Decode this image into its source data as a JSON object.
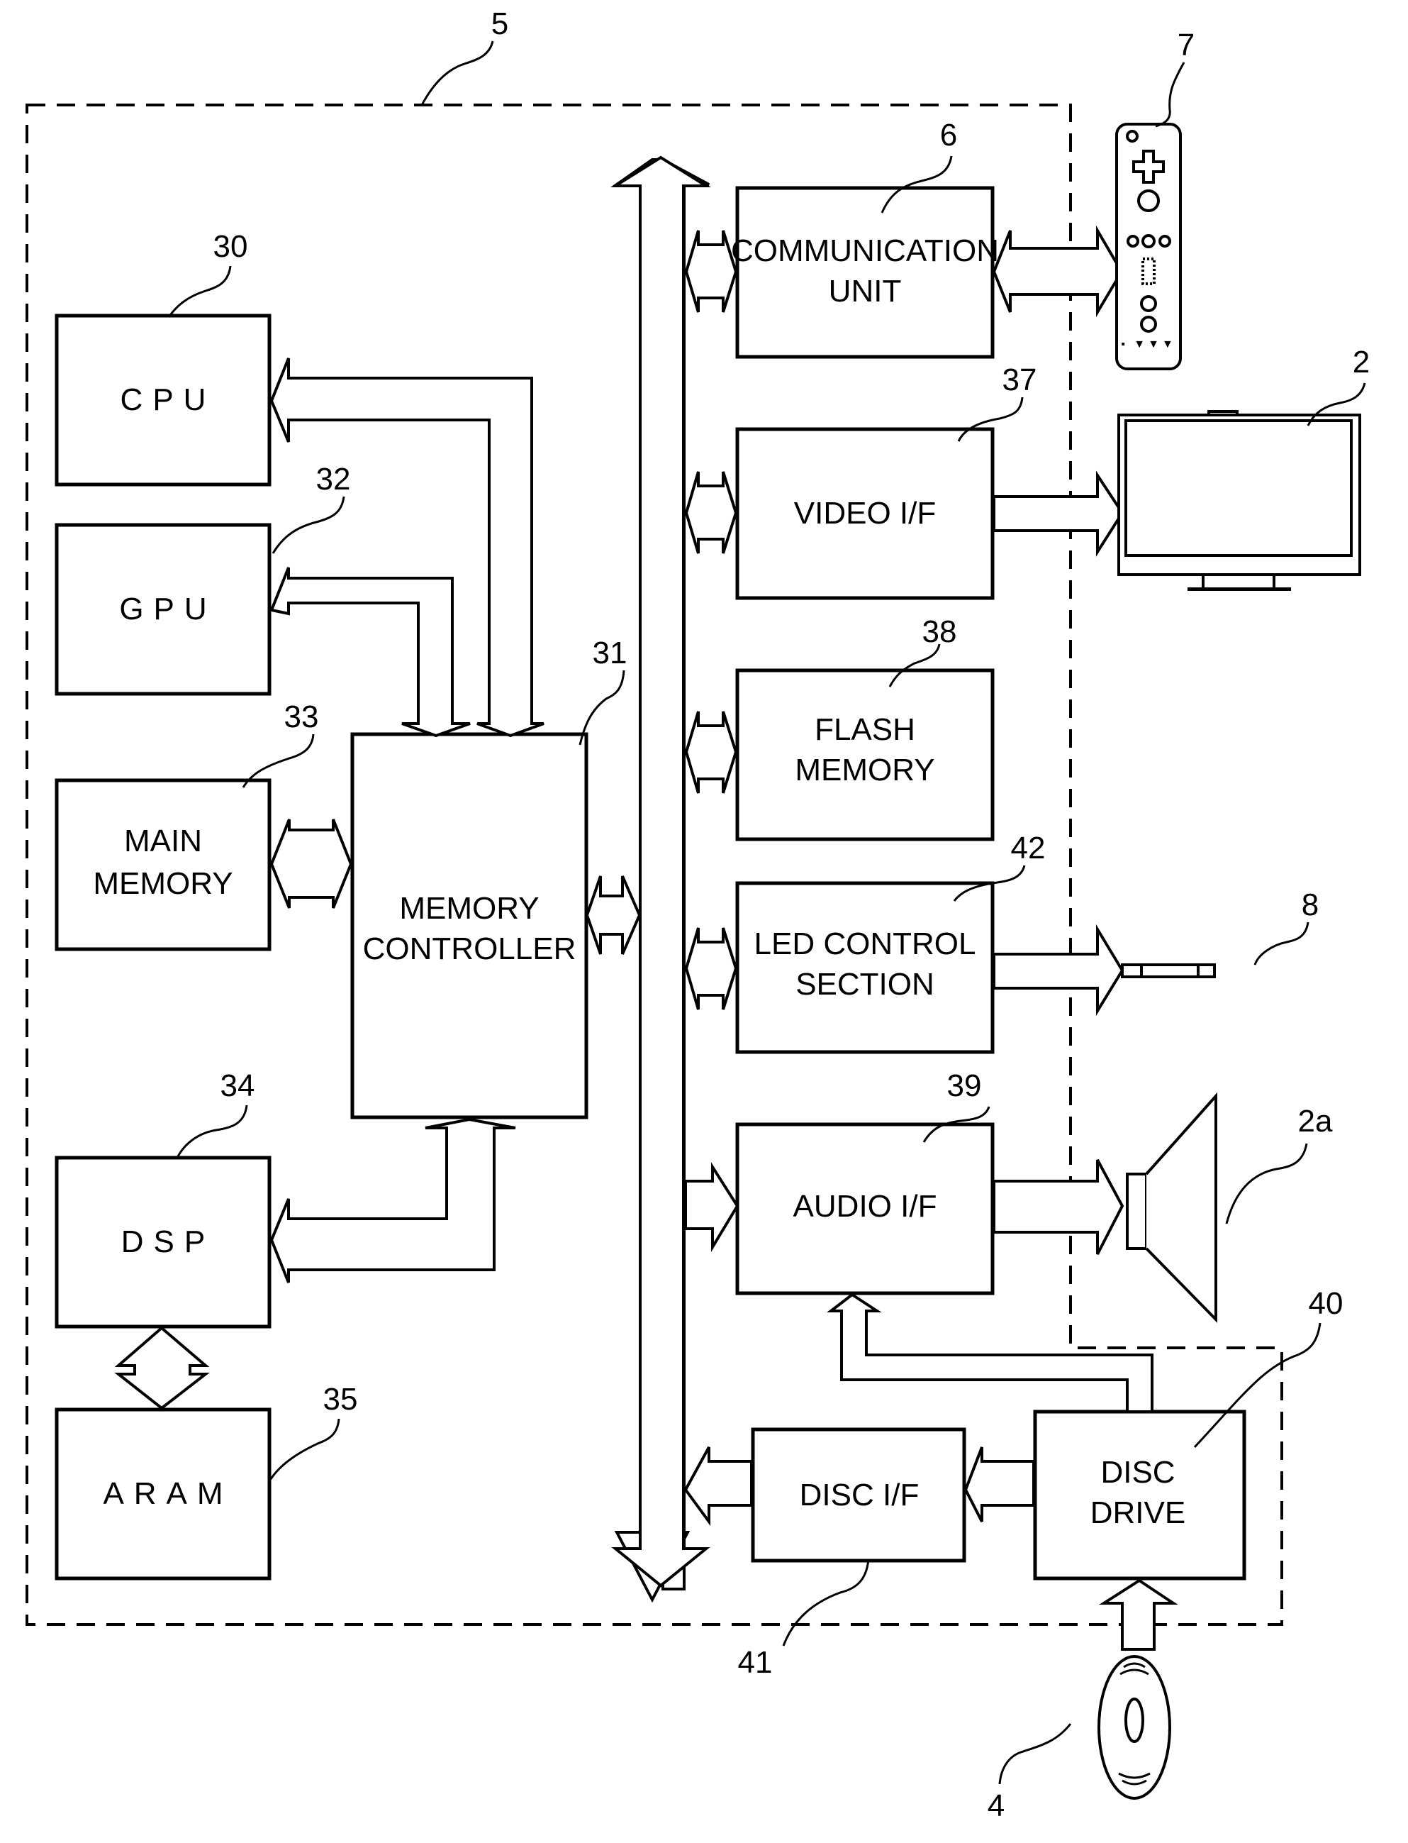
{
  "diagram": {
    "title_ref": "5",
    "blocks": {
      "cpu": {
        "label": "CPU",
        "ref": "30"
      },
      "gpu": {
        "label": "GPU",
        "ref": "32"
      },
      "main_memory": {
        "line1": "MAIN",
        "line2": "MEMORY",
        "ref": "33"
      },
      "memory_controller": {
        "line1": "MEMORY",
        "line2": "CONTROLLER",
        "ref": "31"
      },
      "dsp": {
        "label": "DSP",
        "ref": "34"
      },
      "aram": {
        "label": "ARAM",
        "ref": "35"
      },
      "communication_unit": {
        "line1": "COMMUNICATION",
        "line2": "UNIT",
        "ref": "6"
      },
      "video_if": {
        "label": "VIDEO I/F",
        "ref": "37"
      },
      "flash_memory": {
        "line1": "FLASH",
        "line2": "MEMORY",
        "ref": "38"
      },
      "led_control": {
        "line1": "LED CONTROL",
        "line2": "SECTION",
        "ref": "42"
      },
      "audio_if": {
        "label": "AUDIO I/F",
        "ref": "39"
      },
      "disc_if": {
        "label": "DISC I/F",
        "ref": "41"
      },
      "disc_drive": {
        "line1": "DISC",
        "line2": "DRIVE",
        "ref": "40"
      }
    },
    "devices": {
      "controller": {
        "ref": "7"
      },
      "television": {
        "ref": "2"
      },
      "marker": {
        "ref": "8"
      },
      "speaker": {
        "ref": "2a"
      },
      "optical_disc": {
        "ref": "4"
      }
    }
  }
}
